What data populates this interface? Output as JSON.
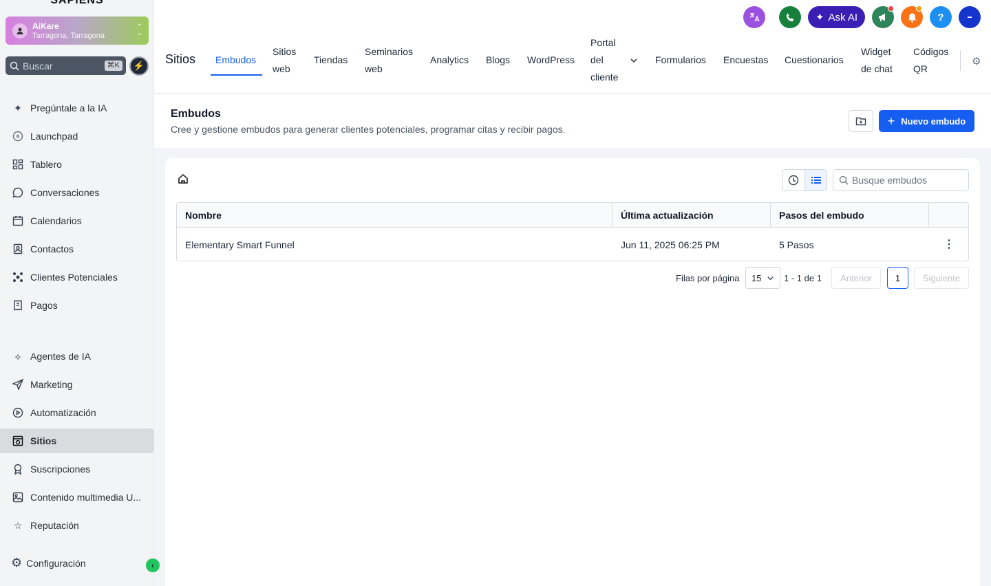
{
  "sidebar": {
    "brand": "SAPIENS",
    "account": {
      "name": "AiKare",
      "location": "Tarragona, Tarragona"
    },
    "search": {
      "placeholder": "Buscar",
      "shortcut": "⌘K"
    },
    "items_top": [
      {
        "label": "Pregúntale a la IA",
        "icon": "sparkles-icon"
      },
      {
        "label": "Launchpad",
        "icon": "launchpad-icon"
      },
      {
        "label": "Tablero",
        "icon": "grid-icon"
      },
      {
        "label": "Conversaciones",
        "icon": "chat-icon"
      },
      {
        "label": "Calendarios",
        "icon": "calendar-icon"
      },
      {
        "label": "Contactos",
        "icon": "contacts-icon"
      },
      {
        "label": "Clientes Potenciales",
        "icon": "leads-icon"
      },
      {
        "label": "Pagos",
        "icon": "receipt-icon"
      }
    ],
    "items_bottom": [
      {
        "label": "Agentes de IA",
        "icon": "ai-agent-icon"
      },
      {
        "label": "Marketing",
        "icon": "send-icon"
      },
      {
        "label": "Automatización",
        "icon": "automation-icon"
      },
      {
        "label": "Sitios",
        "icon": "sites-icon",
        "active": true
      },
      {
        "label": "Suscripciones",
        "icon": "badge-icon"
      },
      {
        "label": "Contenido multimedia U...",
        "icon": "image-icon"
      },
      {
        "label": "Reputación",
        "icon": "star-icon"
      }
    ],
    "settings_label": "Configuración"
  },
  "topbar": {
    "ask_ai_label": "Ask AI",
    "help_label": "?",
    "page_title": "Sitios",
    "tabs": [
      {
        "label": "Embudos",
        "active": true
      },
      {
        "label": "Sitios web"
      },
      {
        "label": "Tiendas"
      },
      {
        "label": "Seminarios web"
      },
      {
        "label": "Analytics"
      },
      {
        "label": "Blogs"
      },
      {
        "label": "WordPress"
      },
      {
        "label": "Portal del cliente"
      },
      {
        "label": "Formularios"
      },
      {
        "label": "Encuestas"
      },
      {
        "label": "Cuestionarios"
      },
      {
        "label": "Widget de chat"
      },
      {
        "label": "Códigos QR"
      }
    ]
  },
  "header": {
    "title": "Embudos",
    "subtitle": "Cree y gestione embudos para generar clientes potenciales, programar citas y recibir pagos.",
    "new_button": "Nuevo embudo"
  },
  "list": {
    "search_placeholder": "Busque embudos",
    "columns": [
      "Nombre",
      "Última actualización",
      "Pasos del embudo"
    ],
    "rows": [
      {
        "name": "Elementary Smart Funnel",
        "updated": "Jun 11, 2025 06:25 PM",
        "steps": "5 Pasos"
      }
    ],
    "pagination": {
      "rows_label": "Filas por página",
      "rows_value": "15",
      "range": "1 - 1 de 1",
      "prev": "Anterior",
      "page": "1",
      "next": "Siguiente"
    }
  },
  "colors": {
    "primary": "#155eef",
    "askai": "#3b1fb5",
    "active_nav": "#d9dbdf"
  }
}
